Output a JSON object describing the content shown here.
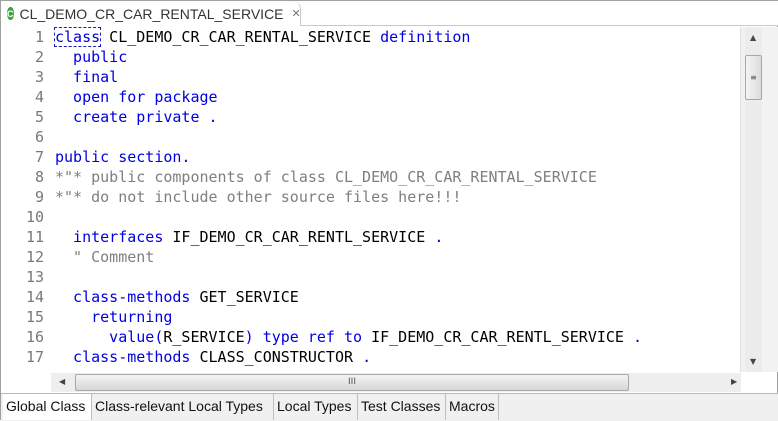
{
  "editor_tab": {
    "title": "CL_DEMO_CR_CAR_RENTAL_SERVICE",
    "icon": "class-icon",
    "close": "✕"
  },
  "lines": [
    {
      "n": "1",
      "parts": [
        [
          "kw",
          "class"
        ],
        [
          "",
          "  CL_DEMO_CR_CAR_RENTAL_SERVICE "
        ],
        [
          "kw",
          "definition"
        ]
      ]
    },
    {
      "n": "2",
      "parts": [
        [
          "kw",
          "  public"
        ]
      ]
    },
    {
      "n": "3",
      "parts": [
        [
          "kw",
          "  final"
        ]
      ]
    },
    {
      "n": "4",
      "parts": [
        [
          "kw",
          "  open for package"
        ]
      ]
    },
    {
      "n": "5",
      "parts": [
        [
          "kw",
          "  create private ."
        ]
      ]
    },
    {
      "n": "6",
      "parts": []
    },
    {
      "n": "7",
      "parts": [
        [
          "kw",
          "public section."
        ]
      ]
    },
    {
      "n": "8",
      "parts": [
        [
          "cm",
          "*\"* public components of class CL_DEMO_CR_CAR_RENTAL_SERVICE"
        ]
      ]
    },
    {
      "n": "9",
      "parts": [
        [
          "cm",
          "*\"* do not include other source files here!!!"
        ]
      ]
    },
    {
      "n": "10",
      "parts": []
    },
    {
      "n": "11",
      "parts": [
        [
          "kw",
          "  interfaces"
        ],
        [
          "",
          " IF_DEMO_CR_CAR_RENTL_SERVICE "
        ],
        [
          "kw",
          "."
        ]
      ]
    },
    {
      "n": "12",
      "parts": [
        [
          "cm",
          "  \" Comment"
        ]
      ]
    },
    {
      "n": "13",
      "parts": []
    },
    {
      "n": "14",
      "parts": [
        [
          "kw",
          "  class-methods"
        ],
        [
          "",
          " GET_SERVICE"
        ]
      ]
    },
    {
      "n": "15",
      "parts": [
        [
          "kw",
          "    returning"
        ]
      ]
    },
    {
      "n": "16",
      "parts": [
        [
          "kw",
          "      value("
        ],
        [
          "",
          "R_SERVICE"
        ],
        [
          "kw",
          ") type ref to"
        ],
        [
          "",
          " IF_DEMO_CR_CAR_RENTL_SERVICE "
        ],
        [
          "kw",
          "."
        ]
      ]
    },
    {
      "n": "17",
      "parts": [
        [
          "kw",
          "  class-methods"
        ],
        [
          "",
          " CLASS_CONSTRUCTOR "
        ],
        [
          "kw",
          "."
        ]
      ]
    }
  ],
  "bottom_tabs": [
    "Global Class",
    "Class-relevant Local Types",
    "Local Types",
    "Test Classes",
    "Macros"
  ],
  "active_bottom_tab": "Global Class"
}
